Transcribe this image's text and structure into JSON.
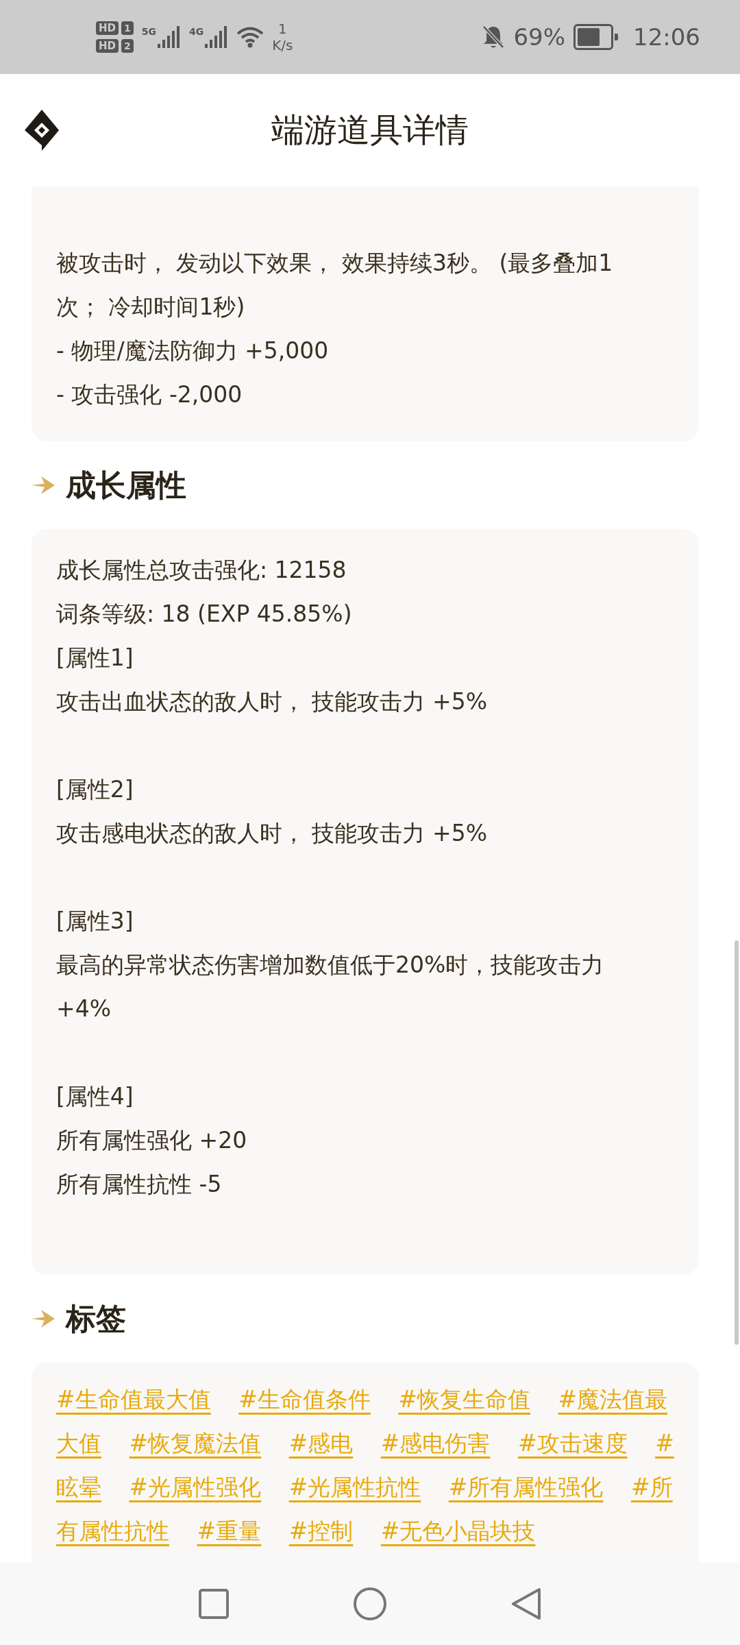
{
  "status_bar": {
    "sims": [
      {
        "label": "HD",
        "slot": "1"
      },
      {
        "label": "HD",
        "slot": "2"
      }
    ],
    "networks": [
      "5G",
      "4G"
    ],
    "speed": {
      "value": "1",
      "unit": "K/s"
    },
    "battery": "69%",
    "time": "12:06"
  },
  "header": {
    "title": "端游道具详情"
  },
  "effect_card": {
    "lines": [
      "被攻击时， 发动以下效果， 效果持续3秒。 (最多叠加1次； 冷却时间1秒)",
      "- 物理/魔法防御力 +5,000",
      "- 攻击强化 -2,000"
    ]
  },
  "growth": {
    "heading": "成长属性",
    "lines": [
      {
        "kind": "text",
        "text": "成长属性总攻击强化: 12158"
      },
      {
        "kind": "text",
        "text": "词条等级: 18 (EXP 45.85%)"
      },
      {
        "kind": "text",
        "text": "[属性1]"
      },
      {
        "kind": "text",
        "text": "攻击出血状态的敌人时， 技能攻击力 +5%"
      },
      {
        "kind": "blank"
      },
      {
        "kind": "text",
        "text": "[属性2]"
      },
      {
        "kind": "text",
        "text": "攻击感电状态的敌人时， 技能攻击力 +5%"
      },
      {
        "kind": "blank"
      },
      {
        "kind": "text",
        "text": "[属性3]"
      },
      {
        "kind": "text",
        "text": "最高的异常状态伤害增加数值低于20%时，技能攻击力 +4%"
      },
      {
        "kind": "blank"
      },
      {
        "kind": "text",
        "text": "[属性4]"
      },
      {
        "kind": "text",
        "text": "所有属性强化 +20"
      },
      {
        "kind": "text",
        "text": "所有属性抗性 -5"
      }
    ]
  },
  "tags": {
    "heading": "标签",
    "items": [
      "#生命值最大值",
      "#生命值条件",
      "#恢复生命值",
      "#魔法值最大值",
      "#恢复魔法值",
      "#感电",
      "#感电伤害",
      "#攻击速度",
      "#眩晕",
      "#光属性强化",
      "#光属性抗性",
      "#所有属性强化",
      "#所有属性抗性",
      "#重量",
      "#控制",
      "#无色小晶块技"
    ]
  }
}
